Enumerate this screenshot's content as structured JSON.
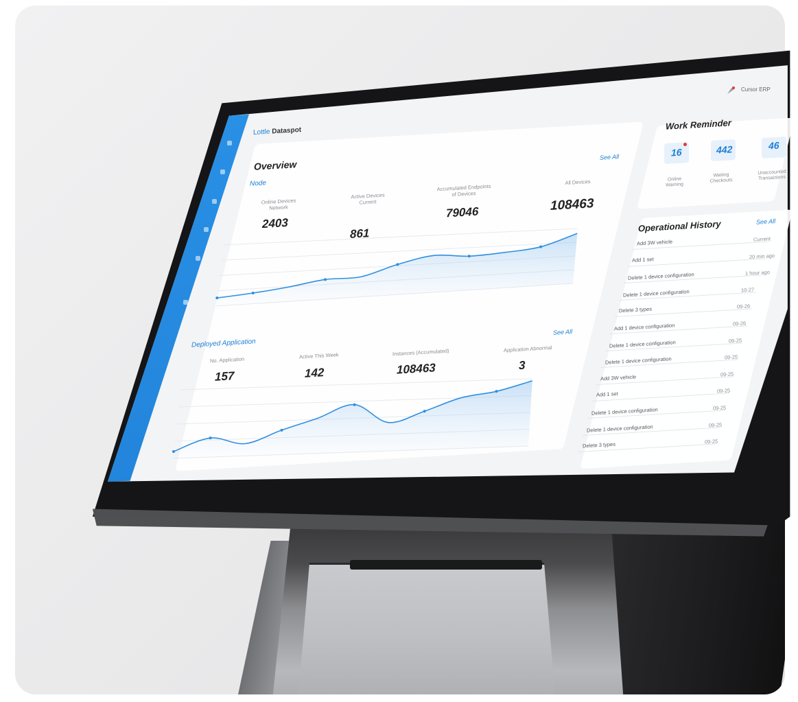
{
  "topbar": {
    "user_label": "Cursor ERP"
  },
  "breadcrumb": {
    "prefix": "Lottle",
    "current": "Dataspot"
  },
  "overview": {
    "title": "Overview",
    "more": "See All",
    "section_label": "Node",
    "stats": [
      {
        "label": "Online Devices Network",
        "value": "2403"
      },
      {
        "label": "Active Devices Current",
        "value": "861"
      },
      {
        "label": "Accumulated Endpoints of Devices",
        "value": "79046"
      },
      {
        "label": "All Devices",
        "value": "108463"
      }
    ]
  },
  "deployed": {
    "title": "Deployed Application",
    "more": "See All",
    "stats": [
      {
        "label": "No. Application",
        "value": "157"
      },
      {
        "label": "Active This Week",
        "value": "142"
      },
      {
        "label": "Instances (Accumulated)",
        "value": "108463"
      },
      {
        "label": "Application Abnormal",
        "value": "3"
      }
    ]
  },
  "work_reminder": {
    "title": "Work Reminder",
    "cards": [
      {
        "value": "16",
        "label": "Online Warning",
        "badge": true
      },
      {
        "value": "442",
        "label": "Waiting Checkouts",
        "badge": false
      },
      {
        "value": "46",
        "label": "Unaccounted Transactions",
        "badge": false
      }
    ]
  },
  "history": {
    "title": "Operational History",
    "more": "See All",
    "items": [
      {
        "text": "Add 3W vehicle",
        "time": "Current"
      },
      {
        "text": "Add 1 set",
        "time": "20 min ago"
      },
      {
        "text": "Delete 1 device configuration",
        "time": "1 hour ago"
      },
      {
        "text": "Delete 1 device configuration",
        "time": "10-27"
      },
      {
        "text": "Delete 3 types",
        "time": "09-26"
      },
      {
        "text": "Add 1 device configuration",
        "time": "09-26"
      },
      {
        "text": "Delete 1 device configuration",
        "time": "09-25"
      },
      {
        "text": "Delete 1 device configuration",
        "time": "09-25"
      },
      {
        "text": "Add 3W vehicle",
        "time": "09-25"
      },
      {
        "text": "Add 1 set",
        "time": "09-25"
      },
      {
        "text": "Delete 1 device configuration",
        "time": "09-25"
      },
      {
        "text": "Delete 1 device configuration",
        "time": "09-25"
      },
      {
        "text": "Delete 3 types",
        "time": "09-25"
      }
    ]
  },
  "colors": {
    "accent": "#1f7fd6",
    "sidebar": "#2a93e8",
    "line": "#2f8fe0"
  },
  "chart_data": [
    {
      "type": "area",
      "title": "",
      "x": [
        1,
        2,
        3,
        4,
        5,
        6,
        7,
        8,
        9,
        10,
        11
      ],
      "series": [
        {
          "values": [
            12,
            16,
            22,
            30,
            31,
            47,
            58,
            54,
            57,
            63,
            82
          ]
        }
      ]
    },
    {
      "type": "area",
      "title": "",
      "x": [
        1,
        2,
        3,
        4,
        5,
        6,
        7,
        8,
        9,
        10,
        11
      ],
      "series": [
        {
          "values": [
            10,
            28,
            18,
            36,
            52,
            70,
            42,
            57,
            75,
            83,
            97
          ]
        }
      ]
    }
  ]
}
